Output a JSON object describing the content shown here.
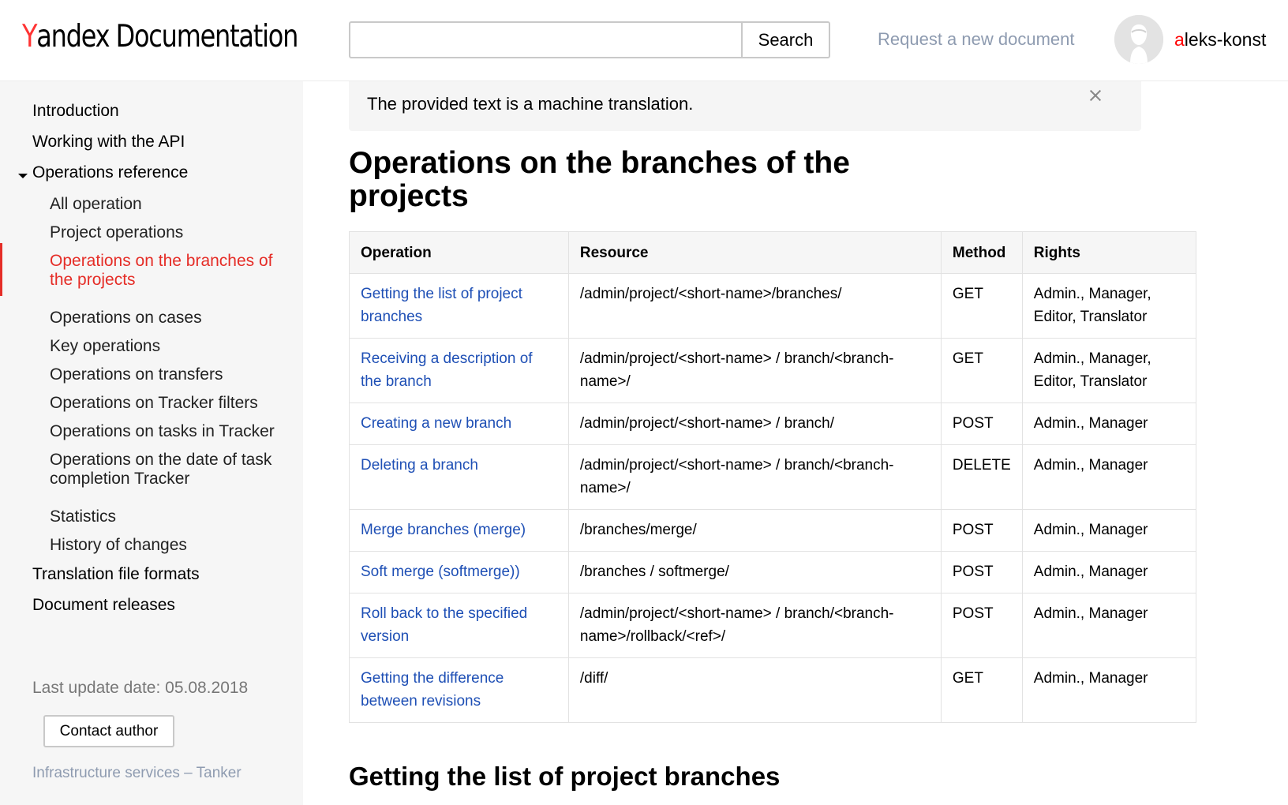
{
  "header": {
    "logo_yandex_first": "Y",
    "logo_yandex_rest": "andex",
    "logo_documentation": "Documentation",
    "search": {
      "value": "",
      "placeholder": "",
      "button_label": "Search"
    },
    "request_link": "Request a new document",
    "user": {
      "first_letter": "a",
      "rest": "leks-konst"
    }
  },
  "sidebar": {
    "items": [
      {
        "label": "Introduction",
        "level": 1
      },
      {
        "label": "Working with the API",
        "level": 1
      },
      {
        "label": "Operations reference",
        "level": 1,
        "expanded": true
      },
      {
        "label": "All operation",
        "level": 2
      },
      {
        "label": "Project operations",
        "level": 2
      },
      {
        "label_line1": "Operations on the branches of",
        "label_line2": "the projects",
        "level": 2,
        "active": true
      },
      {
        "label": "Operations on cases",
        "level": 2
      },
      {
        "label": "Key operations",
        "level": 2
      },
      {
        "label": "Operations on transfers",
        "level": 2
      },
      {
        "label": "Operations on Tracker filters",
        "level": 2
      },
      {
        "label": "Operations on tasks in Tracker",
        "level": 2
      },
      {
        "label_line1": "Operations on the date of task",
        "label_line2": "completion Tracker",
        "level": 2
      },
      {
        "label": "Statistics",
        "level": 2
      },
      {
        "label": "History of changes",
        "level": 2
      },
      {
        "label": "Translation file formats",
        "level": 1
      },
      {
        "label": "Document releases",
        "level": 1
      }
    ],
    "last_update": "Last update date: 05.08.2018",
    "contact_button": "Contact author",
    "footer_link": "Infrastructure services – Tanker"
  },
  "main": {
    "notice": "The provided text is a machine translation.",
    "title": "Operations on the branches of the projects",
    "table": {
      "headers": [
        "Operation",
        "Resource",
        "Method",
        "Rights"
      ],
      "rows": [
        {
          "operation": "Getting the list of project branches",
          "resource": "/admin/project/<short-name>/branches/",
          "method": "GET",
          "rights": "Admin., Manager, Editor, Translator"
        },
        {
          "operation": "Receiving a description of the branch",
          "resource": "/admin/project/<short-name> / branch/<branch-name>/",
          "method": "GET",
          "rights": "Admin., Manager, Editor, Translator"
        },
        {
          "operation": "Creating a new branch",
          "resource": "/admin/project/<short-name> / branch/",
          "method": "POST",
          "rights": "Admin., Manager"
        },
        {
          "operation": "Deleting a branch",
          "resource": "/admin/project/<short-name> / branch/<branch-name>/",
          "method": "DELETE",
          "rights": "Admin., Manager"
        },
        {
          "operation": "Merge branches (merge)",
          "resource": "/branches/merge/",
          "method": "POST",
          "rights": "Admin., Manager"
        },
        {
          "operation": "Soft merge (softmerge))",
          "resource": "/branches / softmerge/",
          "method": "POST",
          "rights": "Admin., Manager"
        },
        {
          "operation": "Roll back to the specified version",
          "resource": "/admin/project/<short-name> / branch/<branch-name>/rollback/<ref>/",
          "method": "POST",
          "rights": "Admin., Manager"
        },
        {
          "operation": "Getting the difference between revisions",
          "resource": "/diff/",
          "method": "GET",
          "rights": "Admin., Manager"
        }
      ]
    },
    "section_title": "Getting the list of project branches"
  },
  "icons": [
    "close-icon",
    "caret-down-icon",
    "avatar-icon"
  ],
  "colors": {
    "brand_red": "#e52d27",
    "link_blue": "#1e4fb5",
    "muted_link": "#8e9bb0"
  }
}
